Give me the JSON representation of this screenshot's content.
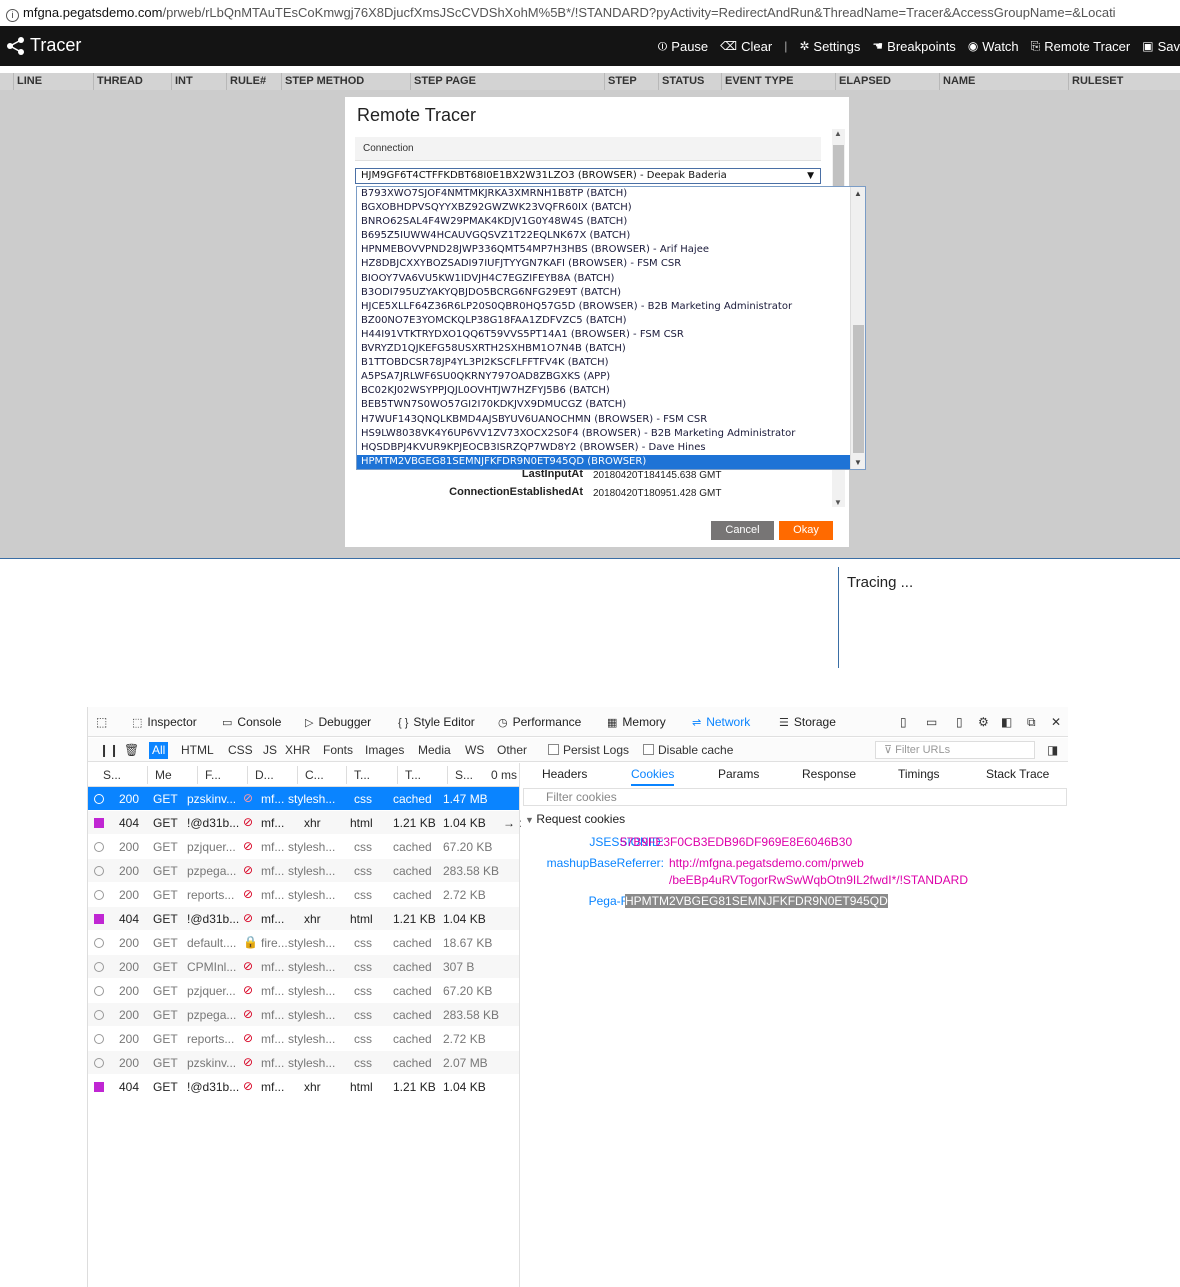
{
  "url": {
    "host": "mfgna.pegatsdemo.com",
    "path": "/prweb/rLbQnMTAuTEsCoKmwgj76X8DjucfXmsJScCVDShXohM%5B*/!STANDARD?pyActivity=RedirectAndRun&ThreadName=Tracer&AccessGroupName=&Locati"
  },
  "tracer": {
    "title": "Tracer",
    "toolbar": {
      "pause": "Pause",
      "clear": "Clear",
      "settings": "Settings",
      "breakpoints": "Breakpoints",
      "watch": "Watch",
      "remote_tracer": "Remote Tracer",
      "save": "Sav"
    },
    "columns": [
      "LINE",
      "THREAD",
      "INT",
      "RULE#",
      "STEP METHOD",
      "STEP PAGE",
      "STEP",
      "STATUS",
      "EVENT TYPE",
      "ELAPSED",
      "NAME",
      "RULESET"
    ],
    "tracing_text": "Tracing ..."
  },
  "modal": {
    "title": "Remote Tracer",
    "connection_header": "Connection",
    "selected_connection": "HJM9GF6T4CTFFKDBT68I0E1BX2W31LZO3 (BROWSER) - Deepak Baderia",
    "fields": [
      {
        "label": "LastInputAt",
        "value": "20180420T184145.638 GMT"
      },
      {
        "label": "ConnectionEstablishedAt",
        "value": "20180420T180951.428 GMT"
      }
    ],
    "cancel_label": "Cancel",
    "okay_label": "Okay"
  },
  "dropdown": {
    "items": [
      "B793XWO7SJOF4NMTMKJRKA3XMRNH1B8TP (BATCH)",
      "BGXOBHDPVSQYYXBZ92GWZWK23VQFR60IX (BATCH)",
      "BNRO62SAL4F4W29PMAK4KDJV1G0Y48W4S (BATCH)",
      "B695Z5IUWW4HCAUVGQSVZ1T22EQLNK67X (BATCH)",
      "HPNMEBOVVPND28JWP336QMT54MP7H3HBS (BROWSER) - Arif Hajee",
      "HZ8DBJCXXYBOZSADI97IUFJTYYGN7KAFI (BROWSER) - FSM CSR",
      "BIOOY7VA6VU5KW1IDVJH4C7EGZIFEYB8A (BATCH)",
      "B3ODI795UZYAKYQBJDO5BCRG6NFG29E9T (BATCH)",
      "HJCE5XLLF64Z36R6LP20S0QBR0HQ57G5D (BROWSER) - B2B Marketing Administrator",
      "BZ00NO7E3YOMCKQLP38G18FAA1ZDFVZC5 (BATCH)",
      "H44I91VTKTRYDXO1QQ6T59VVS5PT14A1 (BROWSER) - FSM CSR",
      "BVRYZD1QJKEFG58USXRTH2SXHBM1O7N4B (BATCH)",
      "B1TTOBDCSR78JP4YL3PI2KSCFLFFTFV4K (BATCH)",
      "A5PSA7JRLWF6SU0QKRNY797OAD8ZBGXKS (APP)",
      "BC02KJ02WSYPPJQJL0OVHTJW7HZFYJ5B6 (BATCH)",
      "BEB5TWN7S0WO57GI2I70KDKJVX9DMUCGZ (BATCH)",
      "H7WUF143QNQLKBMD4AJSBYUV6UANOCHMN (BROWSER) - FSM CSR",
      "HS9LW8038VK4Y6UP6VV1ZV73XOCX2S0F4 (BROWSER) - B2B Marketing Administrator",
      "HQSDBPJ4KVUR9KPJEOCB3ISRZQP7WD8Y2 (BROWSER) - Dave Hines",
      "HPMTM2VBGEG81SEMNJFKFDR9N0ET945QD (BROWSER)"
    ],
    "selected_index": 19
  },
  "devtools": {
    "tabs": [
      {
        "label": "Inspector",
        "icon": "inspector-icon",
        "glyph": "⬚"
      },
      {
        "label": "Console",
        "icon": "console-icon",
        "glyph": "▭"
      },
      {
        "label": "Debugger",
        "icon": "debugger-icon",
        "glyph": "▷"
      },
      {
        "label": "Style Editor",
        "icon": "style-editor-icon",
        "glyph": "{ }"
      },
      {
        "label": "Performance",
        "icon": "performance-icon",
        "glyph": "◷"
      },
      {
        "label": "Memory",
        "icon": "memory-icon",
        "glyph": "▦"
      },
      {
        "label": "Network",
        "icon": "network-icon",
        "glyph": "⇌"
      },
      {
        "label": "Storage",
        "icon": "storage-icon",
        "glyph": "☰"
      }
    ],
    "active_tab": "Network",
    "filters": [
      "All",
      "HTML",
      "CSS",
      "JS",
      "XHR",
      "Fonts",
      "Images",
      "Media",
      "WS",
      "Other"
    ],
    "active_filter": "All",
    "persist_logs": "Persist Logs",
    "disable_cache": "Disable cache",
    "filter_urls_placeholder": "Filter URLs",
    "columns": [
      "S...",
      "Me",
      "F...",
      "D...",
      "C...",
      "T...",
      "T...",
      "S...",
      "0 ms"
    ],
    "rows": [
      {
        "status": "200",
        "method": "GET",
        "file": "pzskinv...",
        "domain": "mf...",
        "cause": "stylesh...",
        "type": "css",
        "transferred": "cached",
        "size": "1.47 MB",
        "marker": "circle"
      },
      {
        "status": "404",
        "method": "GET",
        "file": "!@d31b...",
        "domain": "mf...",
        "cause": "xhr",
        "type": "html",
        "transferred": "1.21 KB",
        "size": "1.04 KB",
        "marker": "square",
        "extra": "→ :"
      },
      {
        "status": "200",
        "method": "GET",
        "file": "pzjquer...",
        "domain": "mf...",
        "cause": "stylesh...",
        "type": "css",
        "transferred": "cached",
        "size": "67.20 KB",
        "marker": "circle"
      },
      {
        "status": "200",
        "method": "GET",
        "file": "pzpega...",
        "domain": "mf...",
        "cause": "stylesh...",
        "type": "css",
        "transferred": "cached",
        "size": "283.58 KB",
        "marker": "circle"
      },
      {
        "status": "200",
        "method": "GET",
        "file": "reports...",
        "domain": "mf...",
        "cause": "stylesh...",
        "type": "css",
        "transferred": "cached",
        "size": "2.72 KB",
        "marker": "circle"
      },
      {
        "status": "404",
        "method": "GET",
        "file": "!@d31b...",
        "domain": "mf...",
        "cause": "xhr",
        "type": "html",
        "transferred": "1.21 KB",
        "size": "1.04 KB",
        "marker": "square"
      },
      {
        "status": "200",
        "method": "GET",
        "file": "default....",
        "domain": "fire...",
        "cause": "stylesh...",
        "type": "css",
        "transferred": "cached",
        "size": "18.67 KB",
        "marker": "circle",
        "secure": true
      },
      {
        "status": "200",
        "method": "GET",
        "file": "CPMInl...",
        "domain": "mf...",
        "cause": "stylesh...",
        "type": "css",
        "transferred": "cached",
        "size": "307 B",
        "marker": "circle"
      },
      {
        "status": "200",
        "method": "GET",
        "file": "pzjquer...",
        "domain": "mf...",
        "cause": "stylesh...",
        "type": "css",
        "transferred": "cached",
        "size": "67.20 KB",
        "marker": "circle"
      },
      {
        "status": "200",
        "method": "GET",
        "file": "pzpega...",
        "domain": "mf...",
        "cause": "stylesh...",
        "type": "css",
        "transferred": "cached",
        "size": "283.58 KB",
        "marker": "circle"
      },
      {
        "status": "200",
        "method": "GET",
        "file": "reports...",
        "domain": "mf...",
        "cause": "stylesh...",
        "type": "css",
        "transferred": "cached",
        "size": "2.72 KB",
        "marker": "circle"
      },
      {
        "status": "200",
        "method": "GET",
        "file": "pzskinv...",
        "domain": "mf...",
        "cause": "stylesh...",
        "type": "css",
        "transferred": "cached",
        "size": "2.07 MB",
        "marker": "circle"
      },
      {
        "status": "404",
        "method": "GET",
        "file": "!@d31b...",
        "domain": "mf...",
        "cause": "xhr",
        "type": "html",
        "transferred": "1.21 KB",
        "size": "1.04 KB",
        "marker": "square"
      }
    ],
    "selected_row": 0,
    "side_tabs": [
      "Headers",
      "Cookies",
      "Params",
      "Response",
      "Timings",
      "Stack Trace"
    ],
    "active_side_tab": "Cookies",
    "filter_cookies_placeholder": "Filter cookies",
    "request_cookies_label": "Request cookies",
    "cookies": [
      {
        "name": "JSESSIONID:",
        "value": "57B9FE3F0CB3EDB96DF969E8E6046B30"
      },
      {
        "name": "mashupBaseReferrer:",
        "value": "http://mfgna.pegatsdemo.com/prweb",
        "value2": "/beEBp4uRVTogorRwSwWqbOtn9IL2fwdI*/!STANDARD"
      },
      {
        "name": "Pega-RULES:",
        "value": "HPMTM2VBGEG81SEMNJFKFDR9N0ET945QD",
        "highlighted": true
      }
    ]
  }
}
